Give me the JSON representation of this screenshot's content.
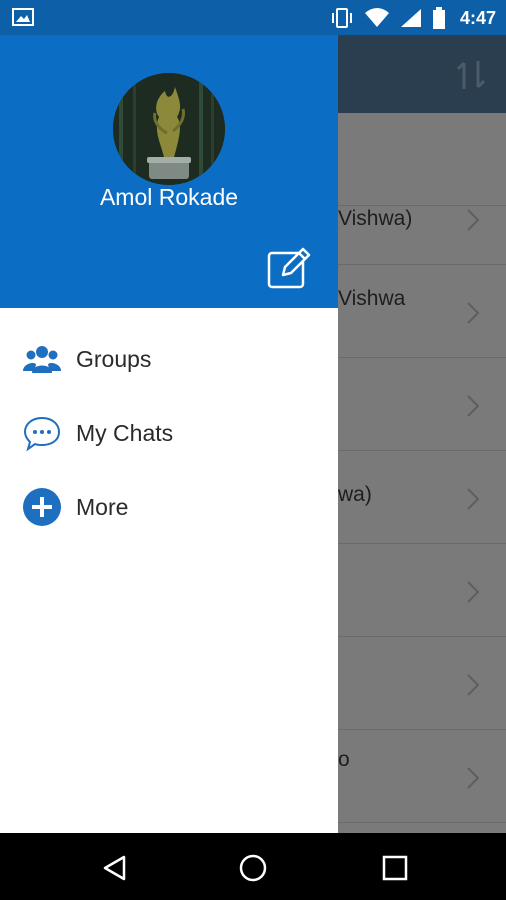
{
  "status_bar": {
    "time": "4:47",
    "icons": [
      "image-icon",
      "vibrate-icon",
      "wifi-icon",
      "signal-icon",
      "battery-icon"
    ]
  },
  "drawer": {
    "user_name": "Amol Rokade",
    "menu": [
      {
        "label": "Groups",
        "icon": "groups-icon"
      },
      {
        "label": "My Chats",
        "icon": "chat-bubble-icon"
      },
      {
        "label": "More",
        "icon": "plus-circle-icon"
      }
    ]
  },
  "background_list": {
    "rows": [
      {
        "text": ""
      },
      {
        "text": "Vishwa)"
      },
      {
        "text": "Vishwa"
      },
      {
        "text": ""
      },
      {
        "text": "wa)"
      },
      {
        "text": ""
      },
      {
        "text": ""
      },
      {
        "text": "o"
      }
    ]
  },
  "colors": {
    "drawer_header": "#0b6ec4",
    "status_bar": "#0d60a8",
    "icon_blue": "#1f6fc0",
    "toolbar_bg": "#2b3e4f"
  },
  "nav_bar": {
    "icons": [
      "back-icon",
      "home-icon",
      "recents-icon"
    ]
  }
}
